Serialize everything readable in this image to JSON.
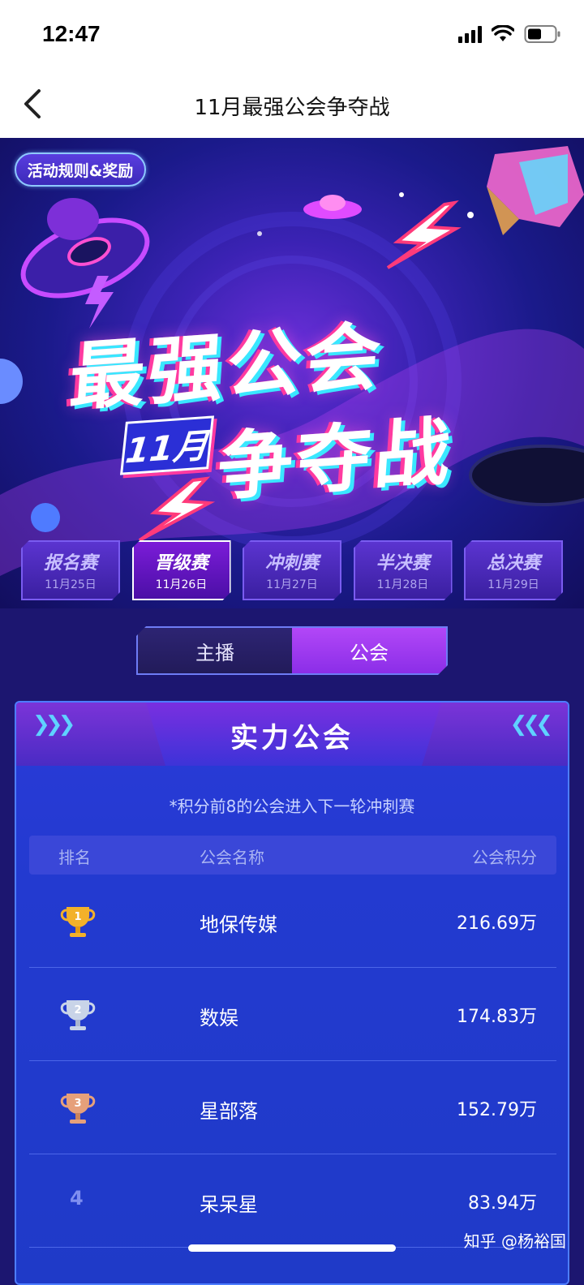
{
  "status": {
    "time": "12:47"
  },
  "nav": {
    "title": "11月最强公会争夺战"
  },
  "banner": {
    "rules_button": "活动规则&奖励",
    "title_line1": "最强公会",
    "month_tag": "11月",
    "title_line2": "争夺战",
    "stages": [
      {
        "name": "报名赛",
        "date": "11月25日",
        "active": false
      },
      {
        "name": "晋级赛",
        "date": "11月26日",
        "active": true
      },
      {
        "name": "冲刺赛",
        "date": "11月27日",
        "active": false
      },
      {
        "name": "半决赛",
        "date": "11月28日",
        "active": false
      },
      {
        "name": "总决赛",
        "date": "11月29日",
        "active": false
      }
    ]
  },
  "toggle": {
    "anchor": "主播",
    "guild": "公会",
    "selected": "guild"
  },
  "panel": {
    "title": "实力公会",
    "note": "*积分前8的公会进入下一轮冲刺赛",
    "columns": {
      "rank": "排名",
      "name": "公会名称",
      "score": "公会积分"
    },
    "rows": [
      {
        "rank": "1",
        "name": "地保传媒",
        "score": "216.69万",
        "medal": "gold"
      },
      {
        "rank": "2",
        "name": "数娱",
        "score": "174.83万",
        "medal": "silver"
      },
      {
        "rank": "3",
        "name": "星部落",
        "score": "152.79万",
        "medal": "bronze"
      },
      {
        "rank": "4",
        "name": "呆呆星",
        "score": "83.94万",
        "medal": ""
      }
    ]
  },
  "watermark": "知乎 @杨裕国",
  "colors": {
    "gold": "#f3b12a",
    "silver": "#c9d4e8",
    "bronze": "#e6a07a",
    "accent": "#9b3cf0"
  }
}
